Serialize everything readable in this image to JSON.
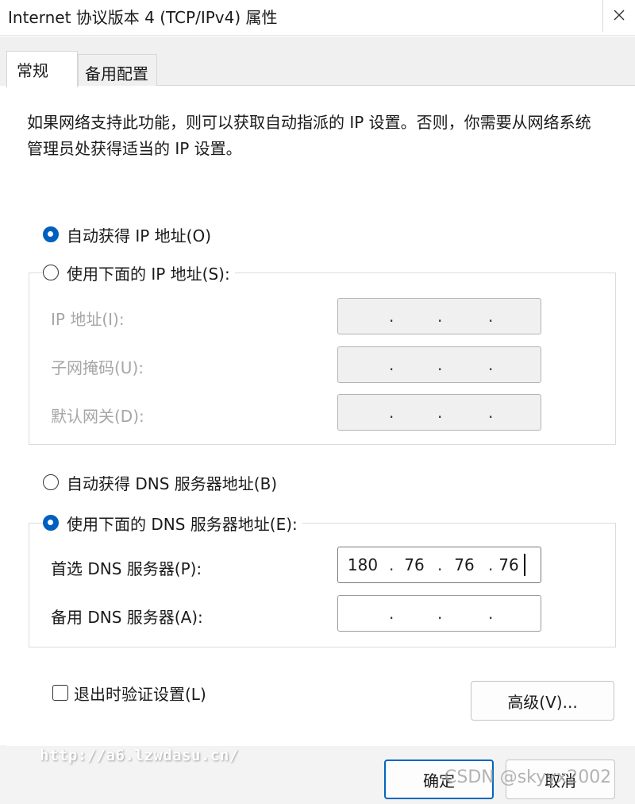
{
  "window": {
    "title": "Internet 协议版本 4 (TCP/IPv4) 属性"
  },
  "tabs": [
    {
      "label": "常规",
      "active": true
    },
    {
      "label": "备用配置",
      "active": false
    }
  ],
  "description": "如果网络支持此功能，则可以获取自动指派的 IP 设置。否则，你需要从网络系统管理员处获得适当的 IP 设置。",
  "ip_section": {
    "auto_radio": {
      "label": "自动获得 IP 地址(O)",
      "checked": true
    },
    "manual_radio": {
      "label": "使用下面的 IP 地址(S):",
      "checked": false
    },
    "fields": [
      {
        "label": "IP 地址(I):",
        "octets": [
          "",
          "",
          "",
          ""
        ],
        "enabled": false
      },
      {
        "label": "子网掩码(U):",
        "octets": [
          "",
          "",
          "",
          ""
        ],
        "enabled": false
      },
      {
        "label": "默认网关(D):",
        "octets": [
          "",
          "",
          "",
          ""
        ],
        "enabled": false
      }
    ]
  },
  "dns_section": {
    "auto_radio": {
      "label": "自动获得 DNS 服务器地址(B)",
      "checked": false
    },
    "manual_radio": {
      "label": "使用下面的 DNS 服务器地址(E):",
      "checked": true
    },
    "fields": [
      {
        "label": "首选 DNS 服务器(P):",
        "octets": [
          "180",
          "76",
          "76",
          "76"
        ],
        "enabled": true
      },
      {
        "label": "备用 DNS 服务器(A):",
        "octets": [
          "",
          "",
          "",
          ""
        ],
        "enabled": true
      }
    ]
  },
  "validate_checkbox": {
    "label": "退出时验证设置(L)",
    "checked": false
  },
  "buttons": {
    "advanced": "高级(V)...",
    "ok": "确定",
    "cancel": "取消"
  },
  "watermarks": {
    "url": "http://a6.lzwdasu.cn/",
    "csdn": "CSDN @skyyx2002"
  },
  "colors": {
    "accent": "#0060c0",
    "disabled_text": "#a6a6a6",
    "disabled_field": "#f0f0f0"
  }
}
